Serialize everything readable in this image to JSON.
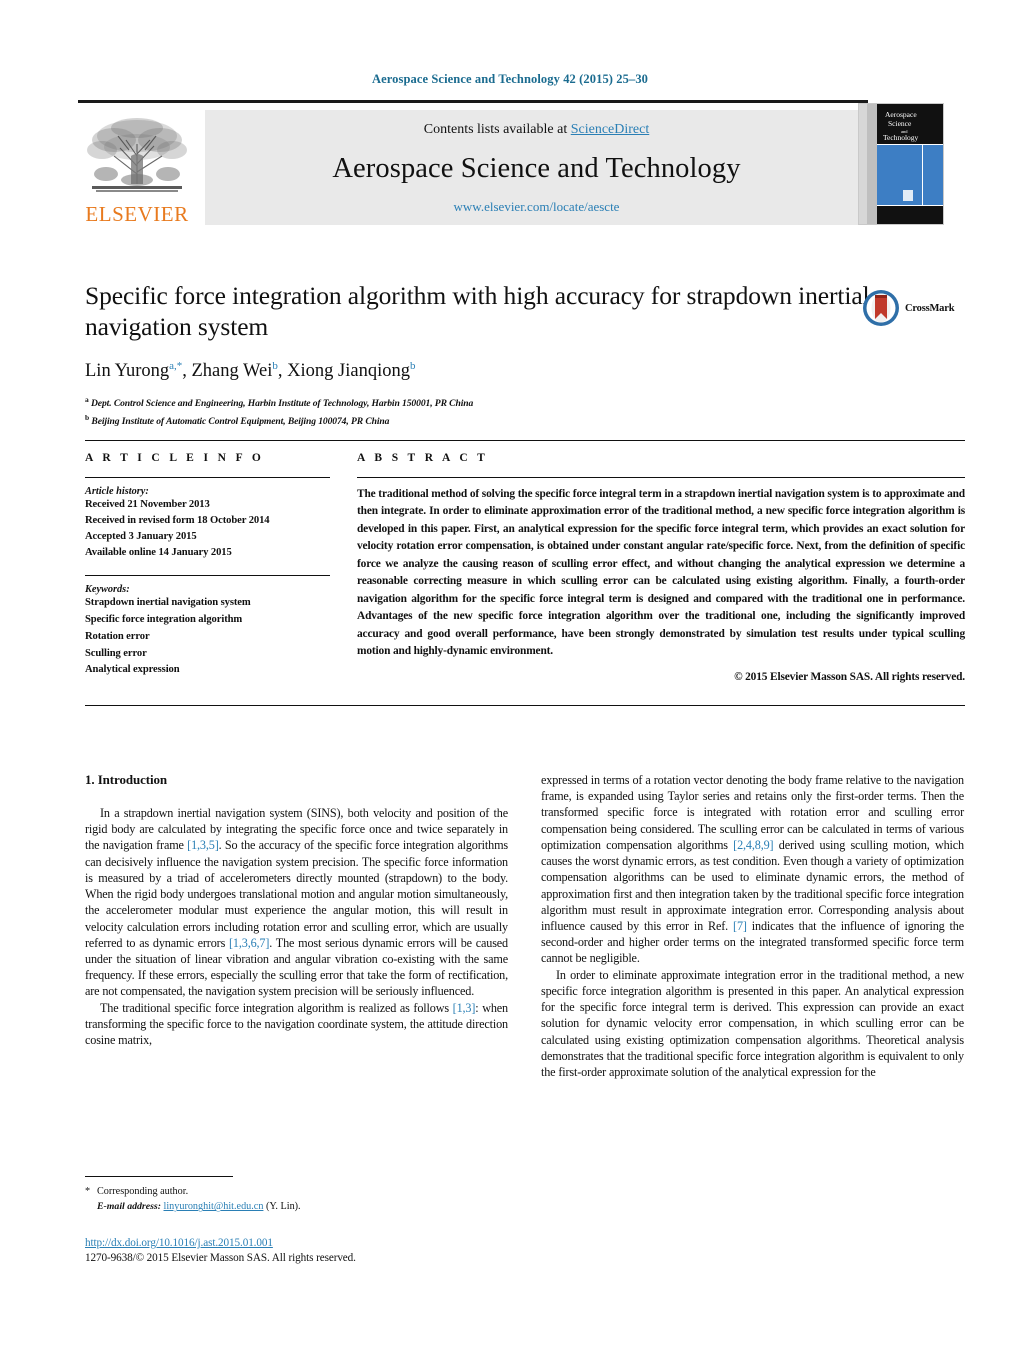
{
  "running_head": "Aerospace Science and Technology 42 (2015) 25–30",
  "masthead": {
    "contents_prefix": "Contents lists available at ",
    "sciencedirect": "ScienceDirect",
    "journal_title": "Aerospace Science and Technology",
    "journal_url": "www.elsevier.com/locate/aescte",
    "publisher": "ELSEVIER",
    "cover_lines": [
      "Aerospace",
      "Science",
      "and",
      "Technology"
    ]
  },
  "article": {
    "title": "Specific force integration algorithm with high accuracy for strapdown inertial navigation system",
    "authors_html": "Lin Yurong<sup>a,<span class=\"star\">*</span></sup>, Zhang Wei<sup>b</sup>, Xiong Jianqiong<sup>b</sup>",
    "affiliations": [
      "Dept. Control Science and Engineering, Harbin Institute of Technology, Harbin 150001, PR China",
      "Beijing Institute of Automatic Control Equipment, Beijing 100074, PR China"
    ],
    "crossmark_label": "CrossMark"
  },
  "article_info": {
    "heading": "A R T I C L E    I N F O",
    "history_label": "Article history:",
    "history": [
      "Received 21 November 2013",
      "Received in revised form 18 October 2014",
      "Accepted 3 January 2015",
      "Available online 14 January 2015"
    ],
    "keywords_label": "Keywords:",
    "keywords": [
      "Strapdown inertial navigation system",
      "Specific force integration algorithm",
      "Rotation error",
      "Sculling error",
      "Analytical expression"
    ]
  },
  "abstract": {
    "heading": "A B S T R A C T",
    "text": "The traditional method of solving the specific force integral term in a strapdown inertial navigation system is to approximate and then integrate. In order to eliminate approximation error of the traditional method, a new specific force integration algorithm is developed in this paper. First, an analytical expression for the specific force integral term, which provides an exact solution for velocity rotation error compensation, is obtained under constant angular rate/specific force. Next, from the definition of specific force we analyze the causing reason of sculling error effect, and without changing the analytical expression we determine a reasonable correcting measure in which sculling error can be calculated using existing algorithm. Finally, a fourth-order navigation algorithm for the specific force integral term is designed and compared with the traditional one in performance. Advantages of the new specific force integration algorithm over the traditional one, including the significantly improved accuracy and good overall performance, have been strongly demonstrated by simulation test results under typical sculling motion and highly-dynamic environment.",
    "copyright": "© 2015 Elsevier Masson SAS. All rights reserved."
  },
  "body": {
    "section_heading": "1. Introduction",
    "left_paragraph_1_html": "In a strapdown inertial navigation system (SINS), both velocity and position of the rigid body are calculated by integrating the specific force once and twice separately in the navigation frame <a class=\"ref\" href=\"#\">[1,3,5]</a>. So the accuracy of the specific force integration algorithms can decisively influence the navigation system precision. The specific force information is measured by a triad of accelerometers directly mounted (strapdown) to the body. When the rigid body undergoes translational motion and angular motion simultaneously, the accelerometer modular must experience the angular motion, this will result in velocity calculation errors including rotation error and sculling error, which are usually referred to as dynamic errors <a class=\"ref\" href=\"#\">[1,3,6,7]</a>. The most serious dynamic errors will be caused under the situation of linear vibration and angular vibration co-existing with the same frequency. If these errors, especially the sculling error that take the form of rectification, are not compensated, the navigation system precision will be seriously influenced.",
    "left_paragraph_2_html": "The traditional specific force integration algorithm is realized as follows <a class=\"ref\" href=\"#\">[1,3]</a>: when transforming the specific force to the navigation coordinate system, the attitude direction cosine matrix,",
    "right_paragraph_1_html": "expressed in terms of a rotation vector denoting the body frame relative to the navigation frame, is expanded using Taylor series and retains only the first-order terms. Then the transformed specific force is integrated with rotation error and sculling error compensation being considered. The sculling error can be calculated in terms of various optimization compensation algorithms <a class=\"ref\" href=\"#\">[2,4,8,9]</a> derived using sculling motion, which causes the worst dynamic errors, as test condition. Even though a variety of optimization compensation algorithms can be used to eliminate dynamic errors, the method of approximation first and then integration taken by the traditional specific force integration algorithm must result in approximate integration error. Corresponding analysis about influence caused by this error in Ref. <a class=\"ref\" href=\"#\">[7]</a> indicates that the influence of ignoring the second-order and higher order terms on the integrated transformed specific force term cannot be negligible.",
    "right_paragraph_2_html": "In order to eliminate approximate integration error in the traditional method, a new specific force integration algorithm is presented in this paper. An analytical expression for the specific force integral term is derived. This expression can provide an exact solution for dynamic velocity error compensation, in which sculling error can be calculated using existing optimization compensation algorithms. Theoretical analysis demonstrates that the traditional specific force integration algorithm is equivalent to only the first-order approximate solution of the analytical expression for the"
  },
  "footnote": {
    "corresponding_author": "Corresponding author.",
    "email_label": "E-mail address:",
    "email": "linyuronghit@hit.edu.cn",
    "email_owner": "(Y. Lin)."
  },
  "footer": {
    "doi": "http://dx.doi.org/10.1016/j.ast.2015.01.001",
    "issn_line": "1270-9638/© 2015 Elsevier Masson SAS. All rights reserved."
  },
  "colors": {
    "link": "#2a7fb5",
    "elsevier_orange": "#e87a1e",
    "cover_blue": "#3d7ec4",
    "masthead_gray": "#e9e9e9"
  }
}
